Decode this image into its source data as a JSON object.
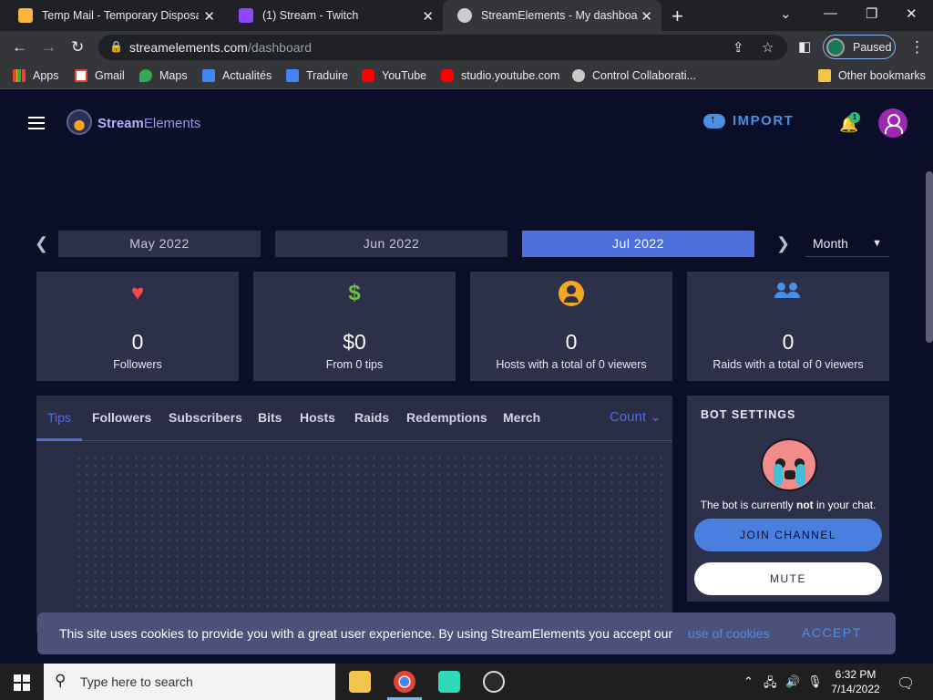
{
  "browser": {
    "tabs": [
      {
        "title": "Temp Mail - Temporary Disposab",
        "icon": "envelope-icon"
      },
      {
        "title": "(1) Stream - Twitch",
        "icon": "twitch-icon"
      },
      {
        "title": "StreamElements - My dashboard",
        "icon": "streamelements-icon"
      }
    ],
    "url_host": "streamelements.com",
    "url_path": "/dashboard",
    "profile_label": "Paused",
    "bookmarks": [
      "Apps",
      "Gmail",
      "Maps",
      "Actualités",
      "Traduire",
      "YouTube",
      "studio.youtube.com",
      "Control Collaborati..."
    ],
    "other_bookmarks": "Other bookmarks"
  },
  "app": {
    "logo_bold": "Stream",
    "logo_rest": "Elements",
    "import_label": "IMPORT",
    "notification_count": "1"
  },
  "months": {
    "items": [
      "May 2022",
      "Jun 2022",
      "Jul 2022"
    ],
    "active": "Jul 2022",
    "period": "Month"
  },
  "stats": [
    {
      "icon": "heart-icon",
      "value": "0",
      "caption": "Followers",
      "color": "#f44a4a"
    },
    {
      "icon": "dollar-icon",
      "value": "$0",
      "caption": "From 0 tips",
      "color": "#6fbf3f"
    },
    {
      "icon": "user-circle-icon",
      "value": "0",
      "caption": "Hosts with a total of 0 viewers",
      "color": "#f5a623"
    },
    {
      "icon": "users-icon",
      "value": "0",
      "caption": "Raids with a total of 0 viewers",
      "color": "#4a90e2"
    }
  ],
  "activity_tabs": [
    "Tips",
    "Followers",
    "Subscribers",
    "Bits",
    "Hosts",
    "Raids",
    "Redemptions",
    "Merch"
  ],
  "activity_active_tab": "Tips",
  "count_label": "Count",
  "bot": {
    "header": "BOT SETTINGS",
    "msg_before": "The bot is currently ",
    "msg_bold": "not",
    "msg_after": " in your chat.",
    "join_label": "JOIN CHANNEL",
    "mute_label": "MUTE"
  },
  "cookie": {
    "text": "This site uses cookies to provide you with a great user experience. By using StreamElements you accept our",
    "link": "use of cookies",
    "accept": "ACCEPT"
  },
  "taskbar": {
    "search_placeholder": "Type here to search",
    "time": "6:32 PM",
    "date": "7/14/2022"
  },
  "colors": {
    "accent": "#4d6fdc",
    "background": "#0b0e29",
    "card": "#2d304b"
  }
}
